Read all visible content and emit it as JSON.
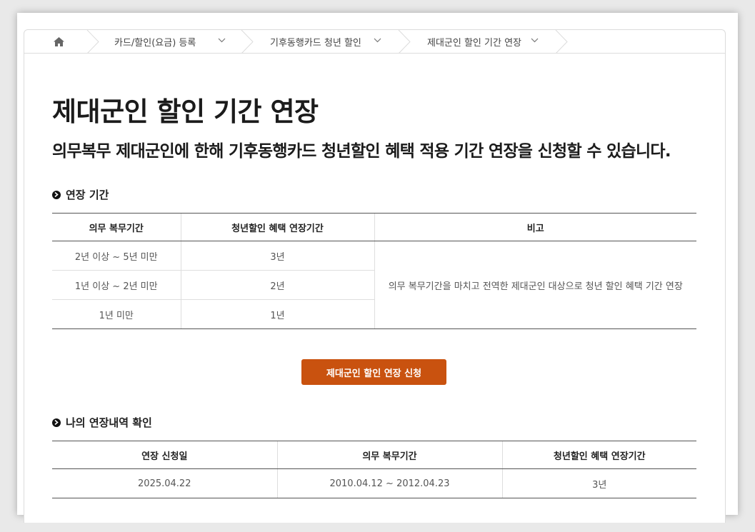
{
  "breadcrumb": {
    "items": [
      {
        "label": "카드/할인(요금) 등록"
      },
      {
        "label": "기후동행카드 청년 할인"
      },
      {
        "label": "제대군인 할인 기간 연장"
      }
    ]
  },
  "page": {
    "title": "제대군인 할인 기간 연장",
    "subtitle": "의무복무 제대군인에 한해 기후동행카드 청년할인 혜택 적용 기간 연장을 신청할 수 있습니다."
  },
  "period_section": {
    "heading": "연장 기간",
    "headers": [
      "의무 복무기간",
      "청년할인 혜택 연장기간",
      "비고"
    ],
    "rows": [
      {
        "service": "2년 이상 ~ 5년 미만",
        "extension": "3년"
      },
      {
        "service": "1년 이상 ~ 2년 미만",
        "extension": "2년"
      },
      {
        "service": "1년 미만",
        "extension": "1년"
      }
    ],
    "note": "의무 복무기간을 마치고 전역한 제대군인 대상으로 청년 할인 혜택 기간 연장"
  },
  "apply_button": {
    "label": "제대군인 할인 연장 신청"
  },
  "history_section": {
    "heading": "나의 연장내역 확인",
    "headers": [
      "연장 신청일",
      "의무 복무기간",
      "청년할인 혜택 연장기간"
    ],
    "rows": [
      {
        "date": "2025.04.22",
        "service": "2010.04.12 ~ 2012.04.23",
        "extension": "3년"
      }
    ]
  },
  "colors": {
    "accent": "#c9520f"
  }
}
